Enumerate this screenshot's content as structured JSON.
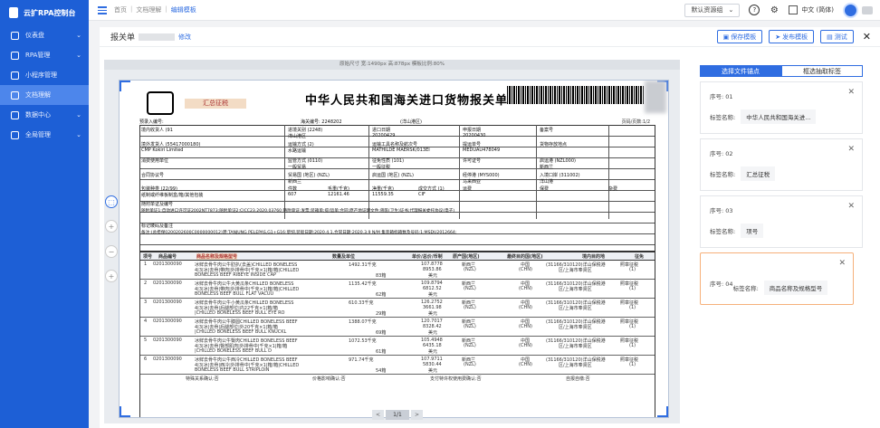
{
  "app": {
    "name": "云扩RPA控制台"
  },
  "sidebar": {
    "items": [
      {
        "label": "仪表盘",
        "chevron": "⌄"
      },
      {
        "label": "RPA管理",
        "chevron": "⌄"
      },
      {
        "label": "小程序管理"
      },
      {
        "label": "文档理解"
      },
      {
        "label": "数据中心",
        "chevron": "⌄"
      },
      {
        "label": "全局管理",
        "chevron": "⌄"
      }
    ]
  },
  "breadcrumb": [
    "首页",
    "文档理解",
    "编辑模板"
  ],
  "topbar": {
    "resource_group": "默认资源组",
    "help": "?",
    "settings": "⚙",
    "language": "中文 (简体)"
  },
  "header": {
    "title": "报关单",
    "modify": "修改",
    "save": "保存模板",
    "publish": "发布模板",
    "test": "测试",
    "close": "✕"
  },
  "viewer": {
    "info": "原始尺寸 宽:1490px 高:878px 模板比例:80%",
    "page": "1/1",
    "prev": "<",
    "next": ">"
  },
  "document": {
    "title": "中华人民共和国海关进口货物报关单",
    "stamp": "汇总征税",
    "page_label": "页码/页数:1/2",
    "lines": [
      "预录入编号:",
      "海关编号: 2248202",
      "(洋山港区)",
      "境内收货人 (91",
      "进境关别 (2248)",
      "进口日期",
      "申报日期",
      "备案号",
      "洋山港区",
      "20200429",
      "20200430",
      "境外发货人 (55417000180)",
      "运输方式 (2)",
      "运输工具名称及航次号",
      "提运单号",
      "货物存放地点",
      "CMP Kokiri Limited",
      "水路运输",
      "MATHILDE MAERSK/013EI",
      "MEDUAU478049",
      "消费使用单位",
      "监管方式 (0110)",
      "征免性质 (101)",
      "许可证号",
      "启运港 (NZL000)",
      "一般贸易",
      "一般征税",
      "新西兰",
      "合同协议号",
      "贸易国 (地区) (NZL)",
      "启运国 (地区) (NZL)",
      "经停港 (MYS000)",
      "入境口岸 (311002)",
      "新西兰",
      "马来西亚",
      "洋山港",
      "包装种类 (22/99)",
      "件数",
      "毛重(千克)",
      "净重(千克)",
      "成交方式 (1)",
      "运费",
      "保费",
      "杂费",
      "纸制或纤维板制盒/箱/其他包装",
      "607",
      "12161.46",
      "11559.35",
      "CIF",
      "随附单证及编号",
      "随附单证1:自动进口许可证2002NT7873;随附单证2:CICC23.2020.03760 随附单证:发票;装箱单;提/运单;合同;原产地证明文件;兽医(卫生)证书;代理报关委托协议(电子)",
      "标记唛码及备注",
      "备注:(总担保0200202600C0000000012)港:TANJUNG PELEPAS,G1+G16:草饲,装船日期:2020.4.1,合同日期:2020.3.9 N/M 集装箱标箱数及号码:1;MSDU2012664;"
    ],
    "item_headers": [
      "项号",
      "商品编号",
      "商品名称及规格型号",
      "数量及单位",
      "单价/总价/币制",
      "原产国(地区)",
      "最终目的国(地区)",
      "境内目的地",
      "征免"
    ],
    "items": [
      {
        "no": "1",
        "code": "0201300090",
        "name": "冰鲜去骨牛肉公牛肋扒(去盖)CHILLED BONELESS",
        "name2": "4|3|冰|去骨|带肉|外排骨中|千克×1|箱/箱|CHILLED",
        "name3": "BONELESS BEEF RIBEYE INSIDE CAP",
        "qty": "1492.31千克",
        "qty2": "83箱",
        "price": "107.8778",
        "total": "8953.86",
        "cur": "美元",
        "origin": "新西兰",
        "origin2": "(NZL)",
        "dest": "中国",
        "dest2": "(CHN)",
        "domestic": "(31166/310120)洋山保税港",
        "domestic2": "区/上海市奉贤区",
        "tax": "照章征税",
        "tax2": "(1)"
      },
      {
        "no": "2",
        "code": "0201300090",
        "name": "冰鲜去骨牛肉公牛大黄瓜条CHILLED BONELESS",
        "name2": "4|3|冰|去骨|带肉|外排骨中|千克×1|箱/箱|CHILLED",
        "name3": "BONELESS BEEF BULL FLAT VACUU",
        "qty": "1135.42千克",
        "qty2": "62箱",
        "price": "109.8794",
        "total": "6812.52",
        "cur": "美元",
        "origin": "新西兰",
        "origin2": "(NZL)",
        "dest": "中国",
        "dest2": "(CHN)",
        "domestic": "(31166/310120)洋山保税港",
        "domestic2": "区/上海市奉贤区",
        "tax": "照章征税",
        "tax2": "(1)"
      },
      {
        "no": "3",
        "code": "0201300090",
        "name": "冰鲜去骨牛肉公牛小黄瓜条CHILLED BONELESS",
        "name2": "4|3|冰|去骨|后腿部位|内22千克×1|箱/箱",
        "name3": "|CHILLED BONELESS BEEF BULL EYE RO",
        "qty": "610.33千克",
        "qty2": "29箱",
        "price": "126.2752",
        "total": "3661.98",
        "cur": "美元",
        "origin": "新西兰",
        "origin2": "(NZL)",
        "dest": "中国",
        "dest2": "(CHN)",
        "domestic": "(31166/310120)洋山保税港",
        "domestic2": "区/上海市奉贤区",
        "tax": "照章征税",
        "tax2": "(1)"
      },
      {
        "no": "4",
        "code": "0201300090",
        "name": "冰鲜去骨牛肉公牛膝圆CHILLED BONELESS BEEF",
        "name2": "4|3|冰|去骨|后腿部位|外20千克×1|箱/箱",
        "name3": "|CHILLED BONELESS BEEF BULL KNUCKL",
        "qty": "1388.07千克",
        "qty2": "69箱",
        "price": "120.7017",
        "total": "8328.42",
        "cur": "美元",
        "origin": "新西兰",
        "origin2": "(NZL)",
        "dest": "中国",
        "dest2": "(CHN)",
        "domestic": "(31166/310120)洋山保税港",
        "domestic2": "区/上海市奉贤区",
        "tax": "照章征税",
        "tax2": "(1)"
      },
      {
        "no": "5",
        "code": "0201300090",
        "name": "冰鲜去骨牛肉公牛臀肉CHILLED BONELESS BEEF",
        "name2": "4|3|冰|去骨|臀部肌肉|外排骨中|千克×1|箱/箱",
        "name3": "|CHILLED BONELESS BEEF BULL D",
        "qty": "1072.53千克",
        "qty2": "61箱",
        "price": "105.4948",
        "total": "6435.18",
        "cur": "美元",
        "origin": "新西兰",
        "origin2": "(NZL)",
        "dest": "中国",
        "dest2": "(CHN)",
        "domestic": "(31166/310120)洋山保税港",
        "domestic2": "区/上海市奉贤区",
        "tax": "照章征税",
        "tax2": "(1)"
      },
      {
        "no": "6",
        "code": "0201300090",
        "name": "冰鲜去骨牛肉公牛西冷CHILLED BONELESS BEEF",
        "name2": "4|3|冰|去骨|西冷|外排骨中|千克×1|箱/箱|CHILLED",
        "name3": "BONELESS BEEF BULL STRIPLOIN",
        "qty": "971.74千克",
        "qty2": "54箱",
        "price": "107.9711",
        "total": "5830.44",
        "cur": "美元",
        "origin": "新西兰",
        "origin2": "(NZL)",
        "dest": "中国",
        "dest2": "(CHN)",
        "domestic": "(31166/310120)洋山保税港",
        "domestic2": "区/上海市奉贤区",
        "tax": "照章征税",
        "tax2": "(1)"
      }
    ],
    "footer": [
      "特殊关系确认:否",
      "价格影响确认:否",
      "支付特许权使用费确认:否",
      "自报自缴:否"
    ]
  },
  "right_panel": {
    "tabs": [
      "选择文件锚点",
      "框选抽取标签"
    ],
    "cards": [
      {
        "seq_label": "序号:",
        "seq": "01",
        "name_label": "标签名称:",
        "name": "中华人民共和国海关进..."
      },
      {
        "seq_label": "序号:",
        "seq": "02",
        "name_label": "标签名称:",
        "name": "汇总征税"
      },
      {
        "seq_label": "序号:",
        "seq": "03",
        "name_label": "标签名称:",
        "name": "项号"
      },
      {
        "seq_label": "序号:",
        "seq": "04",
        "name_label": "标签名称:",
        "name": "商品名称及规格型号"
      }
    ]
  },
  "colors": {
    "primary": "#2f6de1",
    "sidebar": "#1d5fd6",
    "selected_card": "#f6b07a"
  }
}
